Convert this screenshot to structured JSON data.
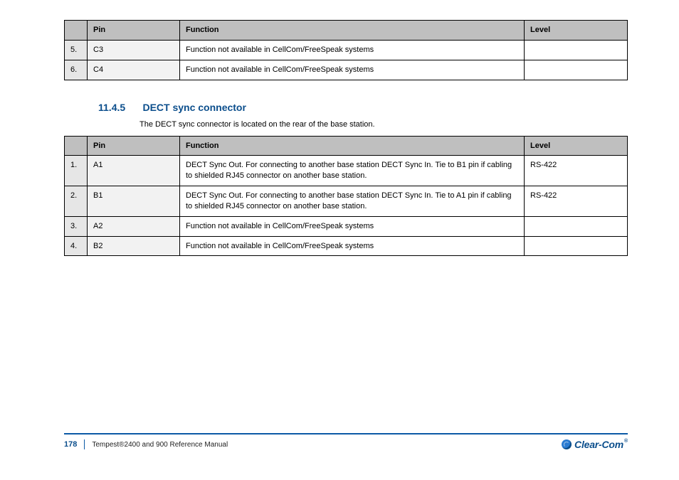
{
  "table1": {
    "headers": [
      "",
      "Pin",
      "Function",
      "Level"
    ],
    "rows": [
      {
        "num": "5.",
        "pin": "C3",
        "func": "Function not available in CellCom/FreeSpeak systems",
        "level": ""
      },
      {
        "num": "6.",
        "pin": "C4",
        "func": "Function not available in CellCom/FreeSpeak systems",
        "level": ""
      }
    ]
  },
  "section": {
    "num": "11.4.5",
    "title": "DECT sync connector",
    "desc": "The DECT sync connector is located on the rear of the base station."
  },
  "table2": {
    "headers": [
      "",
      "Pin",
      "Function",
      "Level"
    ],
    "rows": [
      {
        "num": "1.",
        "pin": "A1",
        "func": "DECT Sync Out. For connecting to another base station DECT Sync In. Tie to B1 pin if cabling to shielded RJ45 connector on another base station.",
        "level": "RS-422"
      },
      {
        "num": "2.",
        "pin": "B1",
        "func": "DECT Sync Out. For connecting to another base station DECT Sync In. Tie to A1 pin if cabling to shielded RJ45 connector on another base station.",
        "level": "RS-422"
      },
      {
        "num": "3.",
        "pin": "A2",
        "func": "Function not available in CellCom/FreeSpeak systems",
        "level": ""
      },
      {
        "num": "4.",
        "pin": "B2",
        "func": "Function not available in CellCom/FreeSpeak systems",
        "level": ""
      }
    ]
  },
  "footer": {
    "page": "178",
    "doc": "Tempest®2400 and 900 Reference Manual"
  },
  "logo_text": "Clear-Com"
}
